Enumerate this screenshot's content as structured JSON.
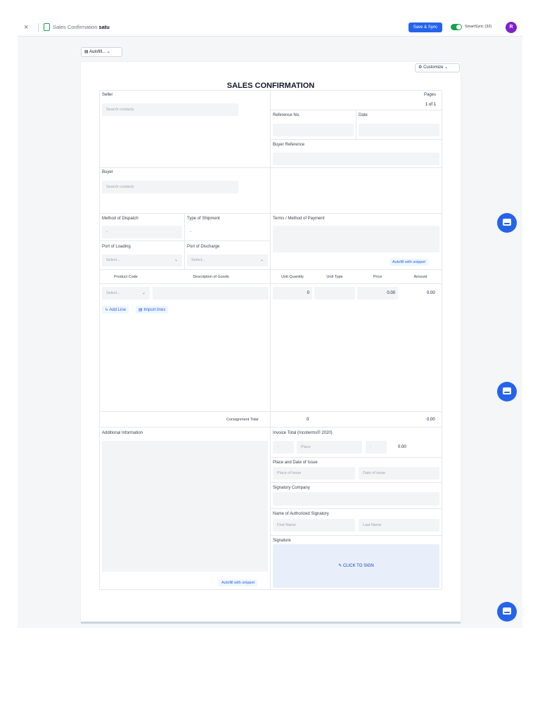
{
  "topbar": {
    "close_glyph": "×",
    "doc_title_prefix": "Sales Confirmation",
    "doc_title_name": "satu",
    "save_label": "Save & Sync",
    "smartsync_label": "SmartSync (32)",
    "avatar_initial": "R"
  },
  "toolbar": {
    "autofill_label": "Autofill...",
    "customize_label": "Customize"
  },
  "form": {
    "title": "SALES CONFIRMATION",
    "seller_label": "Seller",
    "seller_placeholder": "Search contacts",
    "pages_label": "Pages",
    "pages_value": "1 of 1",
    "reference_label": "Reference No.",
    "date_label": "Date",
    "buyer_reference_label": "Buyer Reference",
    "buyer_label": "Buyer",
    "buyer_placeholder": "Search contacts",
    "method_dispatch_label": "Method of Dispatch",
    "method_dispatch_value": "-",
    "type_shipment_label": "Type of Shipment",
    "type_shipment_value": "-",
    "terms_label": "Terms / Method of Payment",
    "port_loading_label": "Port of Loading",
    "port_loading_placeholder": "Select...",
    "port_discharge_label": "Port of Discharge",
    "port_discharge_placeholder": "Select...",
    "terms_snippet_label": "Autofill with snippet",
    "columns": {
      "product_code": "Product Code",
      "description": "Description of Goods",
      "unit_quantity": "Unit Quantity",
      "unit_type": "Unit Type",
      "price": "Price",
      "amount": "Amount"
    },
    "line": {
      "product_placeholder": "Select...",
      "quantity": "0",
      "price": "0.00",
      "amount": "0.00"
    },
    "add_line_label": "Add Line",
    "import_lines_label": "Import lines",
    "consignment_total_label": "Consignment Total",
    "consignment_total_qty": "0",
    "consignment_total_amount": "0.00",
    "additional_info_label": "Additional Information",
    "additional_snippet_label": "Autofill with snippet",
    "invoice_total_label": "Invoice Total (Incoterms® 2020)",
    "invoice_incoterm_value": "-",
    "invoice_place_placeholder": "Place",
    "invoice_currency_value": "-",
    "invoice_total_value": "0.00",
    "place_date_label": "Place and Date of Issue",
    "place_issue_placeholder": "Place of issue",
    "date_issue_placeholder": "Date of issue",
    "signatory_company_label": "Signatory Company",
    "authorized_signatory_label": "Name of Authorized Signatory",
    "first_name_placeholder": "First Name",
    "last_name_placeholder": "Last Name",
    "signature_label": "Signature",
    "click_to_sign_label": "CLICK TO SIGN"
  },
  "colors": {
    "accent": "#2563eb",
    "toggle_on": "#16a34a",
    "avatar": "#7e22ce",
    "sign_bg": "#e8effa"
  },
  "icons": {
    "close": "close-icon",
    "document": "document-icon",
    "clipboard": "clipboard-icon",
    "gear": "gear-icon",
    "chevron": "chevron-down-icon",
    "pen": "pen-icon",
    "chat": "chat-icon"
  }
}
